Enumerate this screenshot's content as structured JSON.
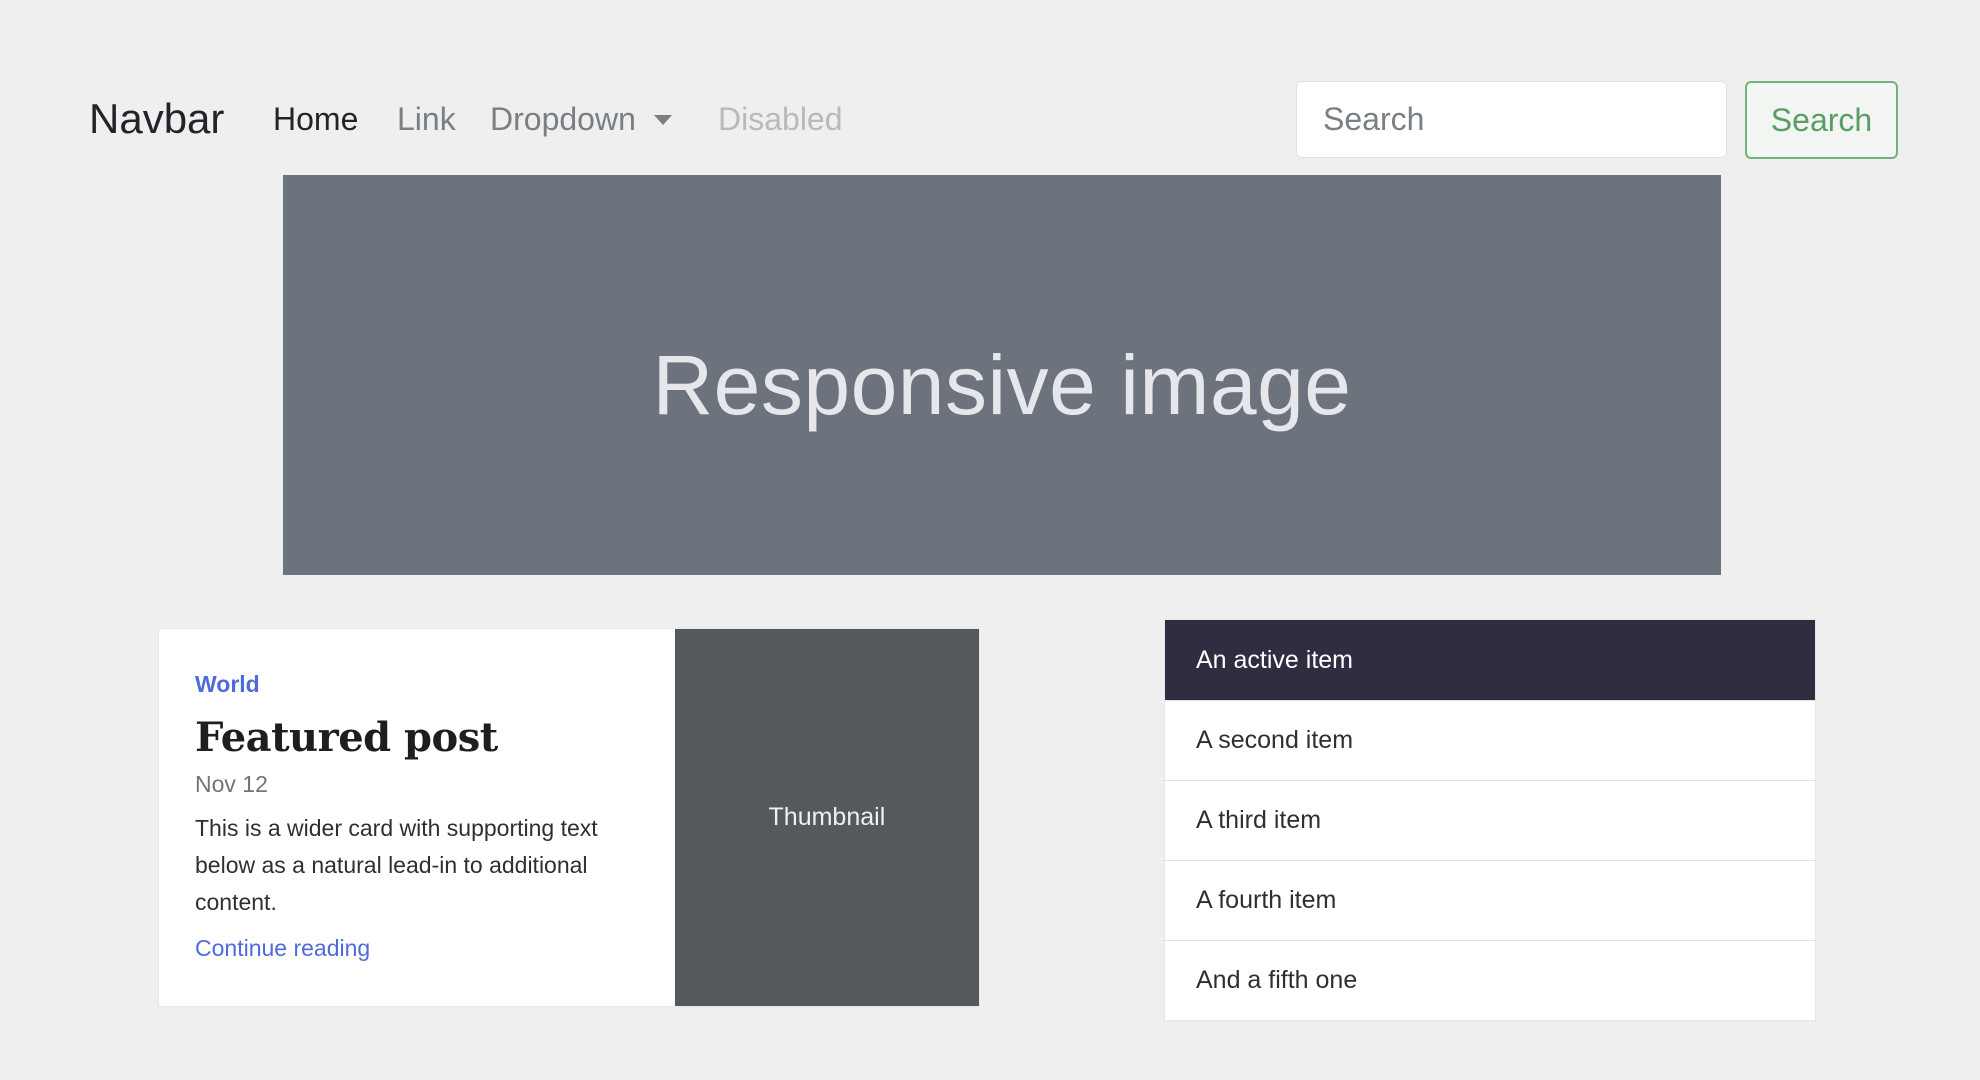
{
  "navbar": {
    "brand": "Navbar",
    "links": {
      "home": "Home",
      "link": "Link",
      "dropdown": "Dropdown",
      "disabled": "Disabled"
    },
    "search": {
      "placeholder": "Search",
      "button_label": "Search"
    }
  },
  "hero": {
    "label": "Responsive image"
  },
  "featured_card": {
    "category": "World",
    "title": "Featured post",
    "date": "Nov 12",
    "text": "This is a wider card with supporting text below as a natural lead-in to additional content.",
    "link_label": "Continue reading",
    "thumbnail_label": "Thumbnail"
  },
  "list_group": {
    "items": [
      {
        "label": "An active item",
        "active": true
      },
      {
        "label": "A second item",
        "active": false
      },
      {
        "label": "A third item",
        "active": false
      },
      {
        "label": "A fourth item",
        "active": false
      },
      {
        "label": "And a fifth one",
        "active": false
      }
    ]
  },
  "colors": {
    "page_background": "#efefef",
    "hero_background": "#6c737c",
    "thumbnail_background": "#55595c",
    "active_item_background": "#2e2e40",
    "link_accent": "#4f6bdb",
    "success_outline": "#78b07d"
  },
  "icons": {
    "dropdown_caret": "chevron-down-icon"
  }
}
